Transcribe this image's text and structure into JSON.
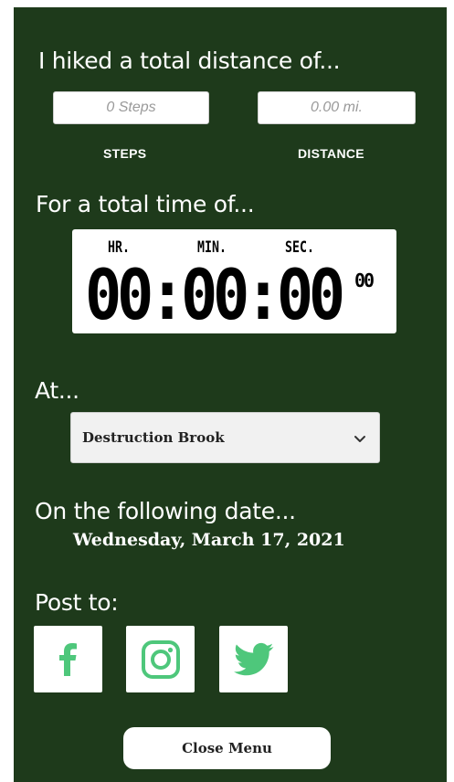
{
  "headings": {
    "distance": "I hiked a total distance of...",
    "time": "For a total time of...",
    "location": "At...",
    "date": "On the following date...",
    "post": "Post to:"
  },
  "steps": {
    "placeholder": "0 Steps",
    "label": "STEPS"
  },
  "distance": {
    "placeholder": "0.00 mi.",
    "label": "DISTANCE"
  },
  "stopwatch": {
    "hr_label": "HR.",
    "min_label": "MIN.",
    "sec_label": "SEC.",
    "display": "00:00:00",
    "hundredths": "00"
  },
  "location": {
    "selected": "Destruction Brook",
    "icon": "chevron-down-icon"
  },
  "date": {
    "value": "Wednesday, March 17, 2021"
  },
  "social": [
    {
      "name": "facebook",
      "icon": "facebook-icon"
    },
    {
      "name": "instagram",
      "icon": "instagram-icon"
    },
    {
      "name": "twitter",
      "icon": "twitter-icon"
    }
  ],
  "close_button": {
    "label": "Close Menu"
  },
  "colors": {
    "panel_bg": "#1e3a1b",
    "social_green": "#4ec77b",
    "text": "#ffffff"
  }
}
